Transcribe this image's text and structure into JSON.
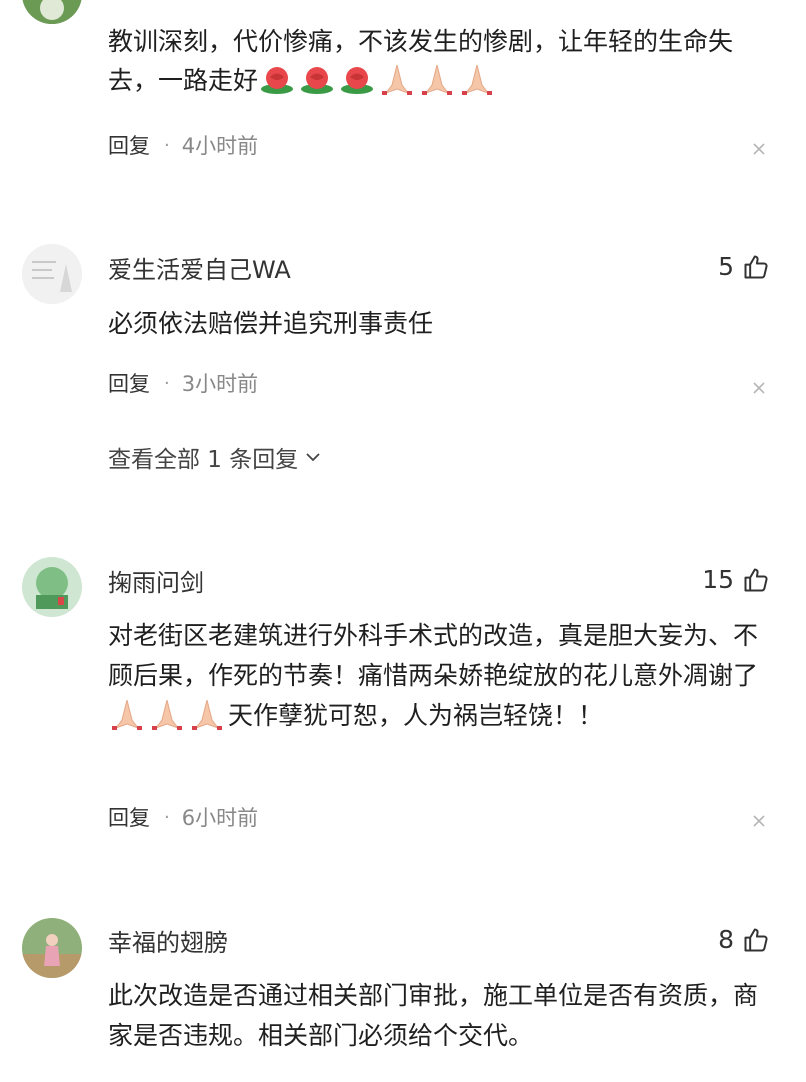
{
  "comments": [
    {
      "text": "教训深刻，代价惨痛，不该发生的惨剧，让年轻的生命失去，一路走好",
      "emoji": [
        "rose",
        "rose",
        "rose",
        "pray",
        "pray",
        "pray"
      ],
      "reply_label": "回复",
      "time": "4小时前"
    },
    {
      "username": "爱生活爱自己WA",
      "likes": "5",
      "text": "必须依法赔偿并追究刑事责任",
      "reply_label": "回复",
      "time": "3小时前",
      "view_all": "查看全部 1 条回复"
    },
    {
      "username": "掬雨问剑",
      "likes": "15",
      "text_before": "对老街区老建筑进行外科手术式的改造，真是胆大妄为、不顾后果，作死的节奏！痛惜两朵娇艳绽放的花儿意外凋谢了",
      "emoji": [
        "pray",
        "pray",
        "pray"
      ],
      "text_after": "天作孽犹可恕，人为祸岂轻饶！！",
      "reply_label": "回复",
      "time": "6小时前"
    },
    {
      "username": "幸福的翅膀",
      "likes": "8",
      "text": "此次改造是否通过相关部门审批，施工单位是否有资质，商家是否违规。相关部门必须给个交代。"
    }
  ],
  "icons": {
    "like": "thumbs-up-icon",
    "close": "close-icon",
    "chevron": "chevron-down-icon",
    "rose": "rose-emoji-icon",
    "pray": "pray-emoji-icon"
  },
  "colors": {
    "rose": "#e8484b",
    "leaf": "#3a9a46",
    "pray": "#f6c6a8"
  }
}
